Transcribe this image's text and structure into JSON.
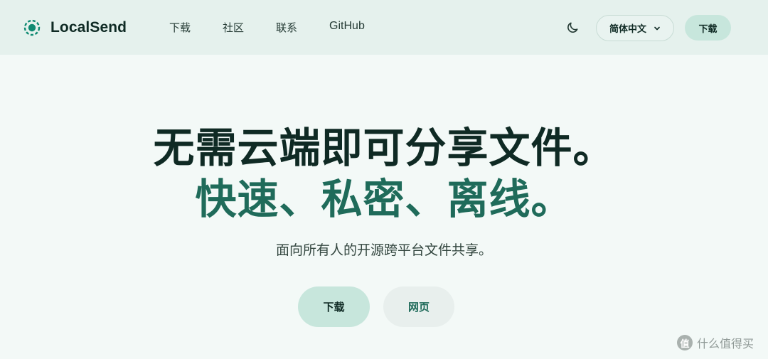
{
  "brand": {
    "name": "LocalSend",
    "logo_icon": "localsend-logo-icon",
    "accent_color": "#0f8a72"
  },
  "nav": {
    "links": [
      "下载",
      "社区",
      "联系",
      "GitHub"
    ],
    "theme_icon": "moon-icon",
    "language": {
      "selected": "简体中文",
      "icon": "chevron-down-icon"
    },
    "download_label": "下载"
  },
  "hero": {
    "title": "无需云端即可分享文件。",
    "accent": "快速、私密、离线。",
    "subtitle": "面向所有人的开源跨平台文件共享。",
    "buttons": {
      "download": "下载",
      "web": "网页"
    }
  },
  "watermark": {
    "text": "什么值得买",
    "icon": "zhi-badge-icon",
    "icon_glyph": "值"
  },
  "colors": {
    "background": "#f3f9f7",
    "nav_bg": "#e5f1ed",
    "accent_text": "#1f6b5a",
    "button_bg": "#c7e6dc"
  }
}
